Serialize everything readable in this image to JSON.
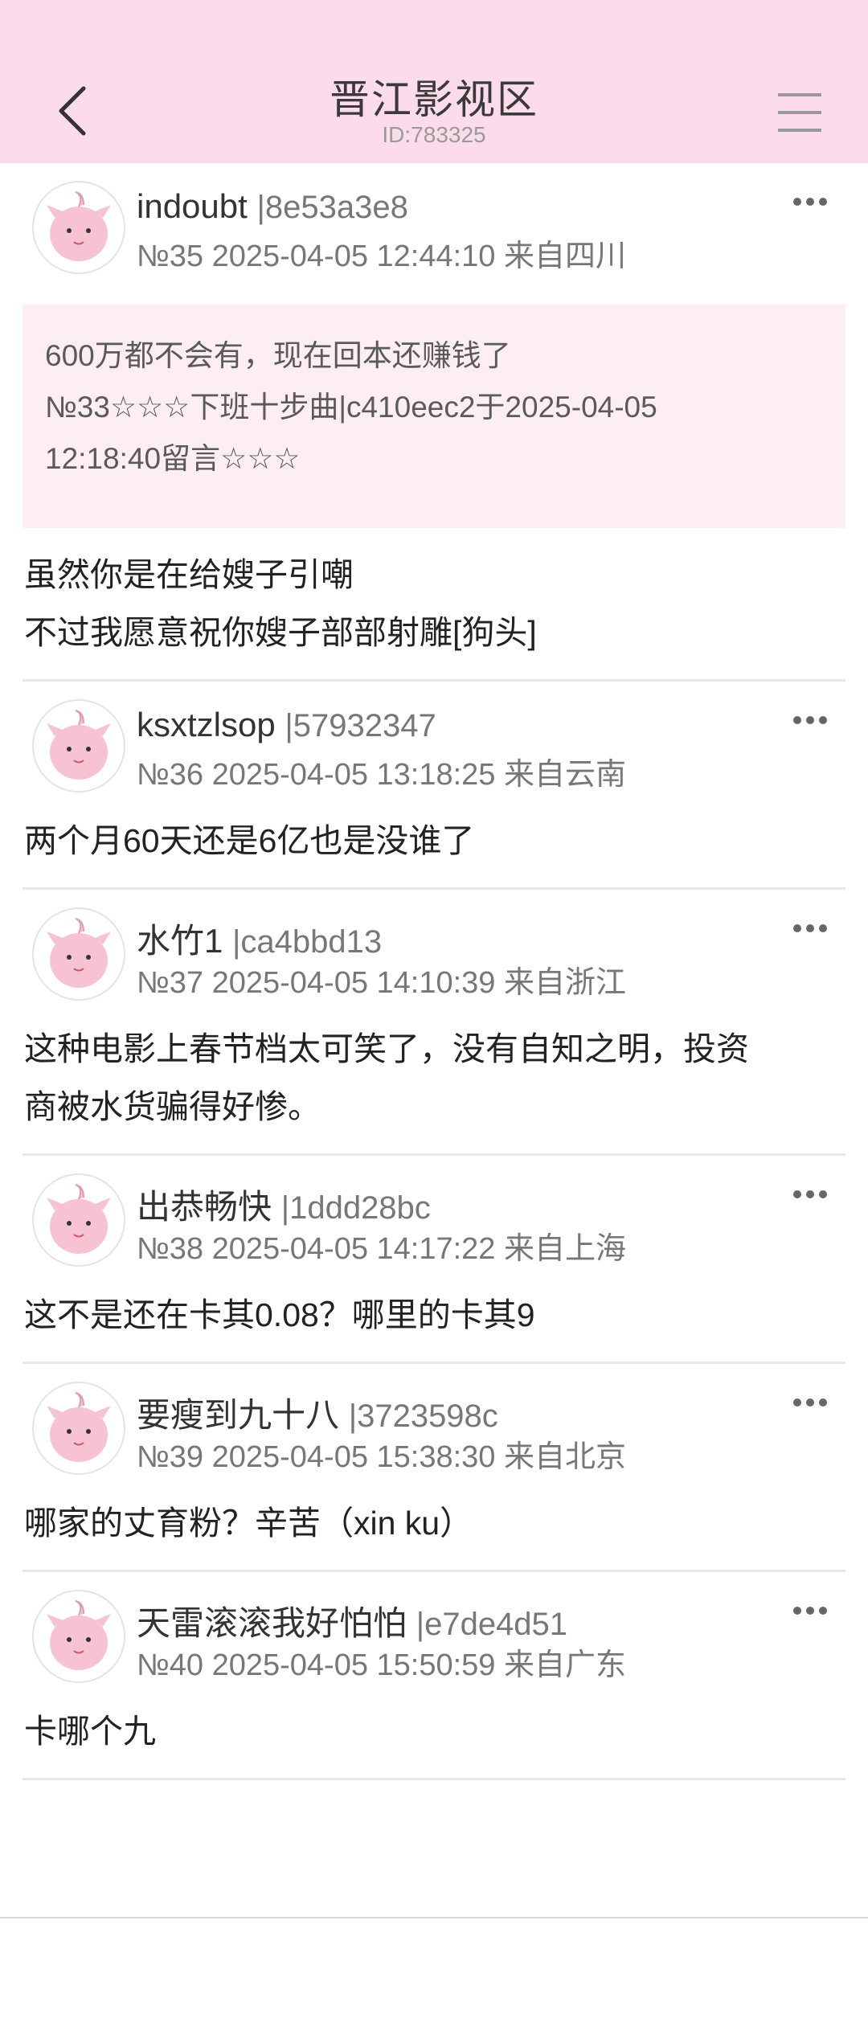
{
  "header": {
    "title": "晋江影视区",
    "id_label": "ID:783325"
  },
  "posts": [
    {
      "author": "indoubt",
      "hash": "|8e53a3e8",
      "meta": "№35 2025-04-05 12:44:10 来自四川",
      "quote": {
        "line1": "600万都不会有，现在回本还赚钱了",
        "line2": "№33☆☆☆下班十步曲|c410eec2于2025-04-05",
        "line3": "12:18:40留言☆☆☆"
      },
      "body": [
        "虽然你是在给嫂子引嘲",
        "不过我愿意祝你嫂子部部射雕[狗头]"
      ]
    },
    {
      "author": "ksxtzlsop",
      "hash": "|57932347",
      "meta": "№36 2025-04-05 13:18:25 来自云南",
      "body": [
        "两个月60天还是6亿也是没谁了"
      ]
    },
    {
      "author": "水竹1",
      "hash": "|ca4bbd13",
      "meta": "№37 2025-04-05 14:10:39 来自浙江",
      "body": [
        "这种电影上春节档太可笑了，没有自知之明，投资",
        "商被水货骗得好惨。"
      ]
    },
    {
      "author": "出恭畅快",
      "hash": "|1ddd28bc",
      "meta": "№38 2025-04-05 14:17:22 来自上海",
      "body": [
        "这不是还在卡其0.08？哪里的卡其9"
      ]
    },
    {
      "author": "要瘦到九十八",
      "hash": "|3723598c",
      "meta": "№39 2025-04-05 15:38:30 来自北京",
      "body": [
        "哪家的丈育粉？辛苦（xin ku）"
      ]
    },
    {
      "author": "天雷滚滚我好怕怕",
      "hash": "|e7de4d51",
      "meta": "№40 2025-04-05 15:50:59 来自广东",
      "body": [
        "卡哪个九"
      ]
    }
  ],
  "icons": {
    "back": "chevron-left-icon",
    "menu": "hamburger-menu-icon",
    "more": "more-dots-icon",
    "avatar": "pink-creature-avatar"
  },
  "colors": {
    "header_bg": "#fcdcea",
    "quote_bg": "#fdeef4",
    "avatar_pink": "#f7c3d3"
  }
}
